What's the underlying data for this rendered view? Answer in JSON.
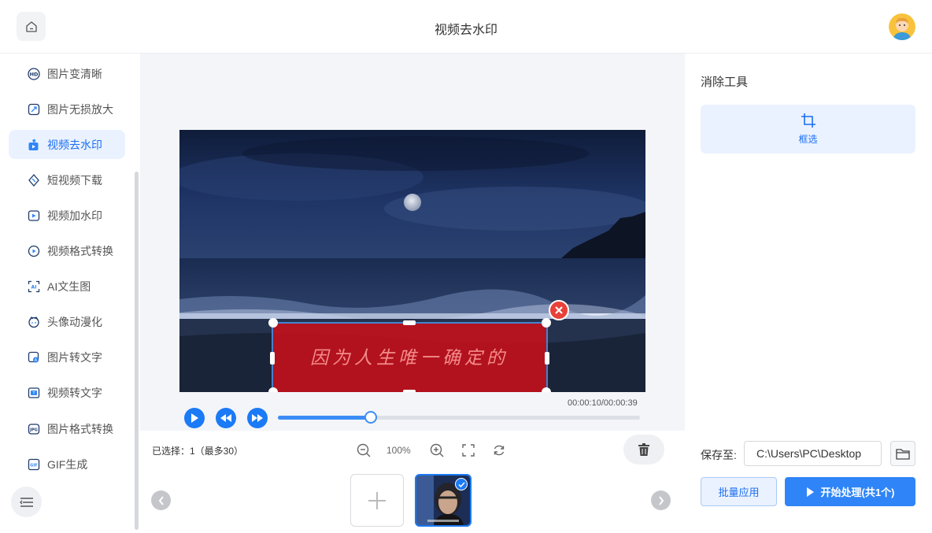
{
  "header": {
    "title": "视频去水印"
  },
  "sidebar": {
    "items": [
      {
        "label": "图片变清晰",
        "icon": "hd-icon"
      },
      {
        "label": "图片无损放大",
        "icon": "enlarge-icon"
      },
      {
        "label": "视频去水印",
        "icon": "video-eraser-icon",
        "active": true
      },
      {
        "label": "短视频下载",
        "icon": "download-icon"
      },
      {
        "label": "视频加水印",
        "icon": "video-watermark-icon"
      },
      {
        "label": "视频格式转换",
        "icon": "video-convert-icon"
      },
      {
        "label": "AI文生图",
        "icon": "ai-image-icon"
      },
      {
        "label": "头像动漫化",
        "icon": "avatar-anime-icon"
      },
      {
        "label": "图片转文字",
        "icon": "image-to-text-icon"
      },
      {
        "label": "视频转文字",
        "icon": "video-to-text-icon"
      },
      {
        "label": "图片格式转换",
        "icon": "image-convert-icon"
      },
      {
        "label": "GIF生成",
        "icon": "gif-icon"
      }
    ]
  },
  "player": {
    "subtitle_text": "因为人生唯一确定的",
    "timecode": "00:00:10/00:00:39",
    "progress": 0.257
  },
  "toolbar": {
    "selected_info": "已选择：1（最多30）",
    "zoom_level": "100%"
  },
  "right_panel": {
    "title": "消除工具",
    "tool_label": "框选",
    "save_label": "保存至:",
    "save_path": "C:\\Users\\PC\\Desktop",
    "batch_label": "批量应用",
    "start_label": "开始处理(共1个)"
  },
  "colors": {
    "accent": "#1b7af5",
    "accent_light": "#eaf2ff",
    "selection_fill": "#c8101a",
    "close_red": "#e8413a"
  }
}
